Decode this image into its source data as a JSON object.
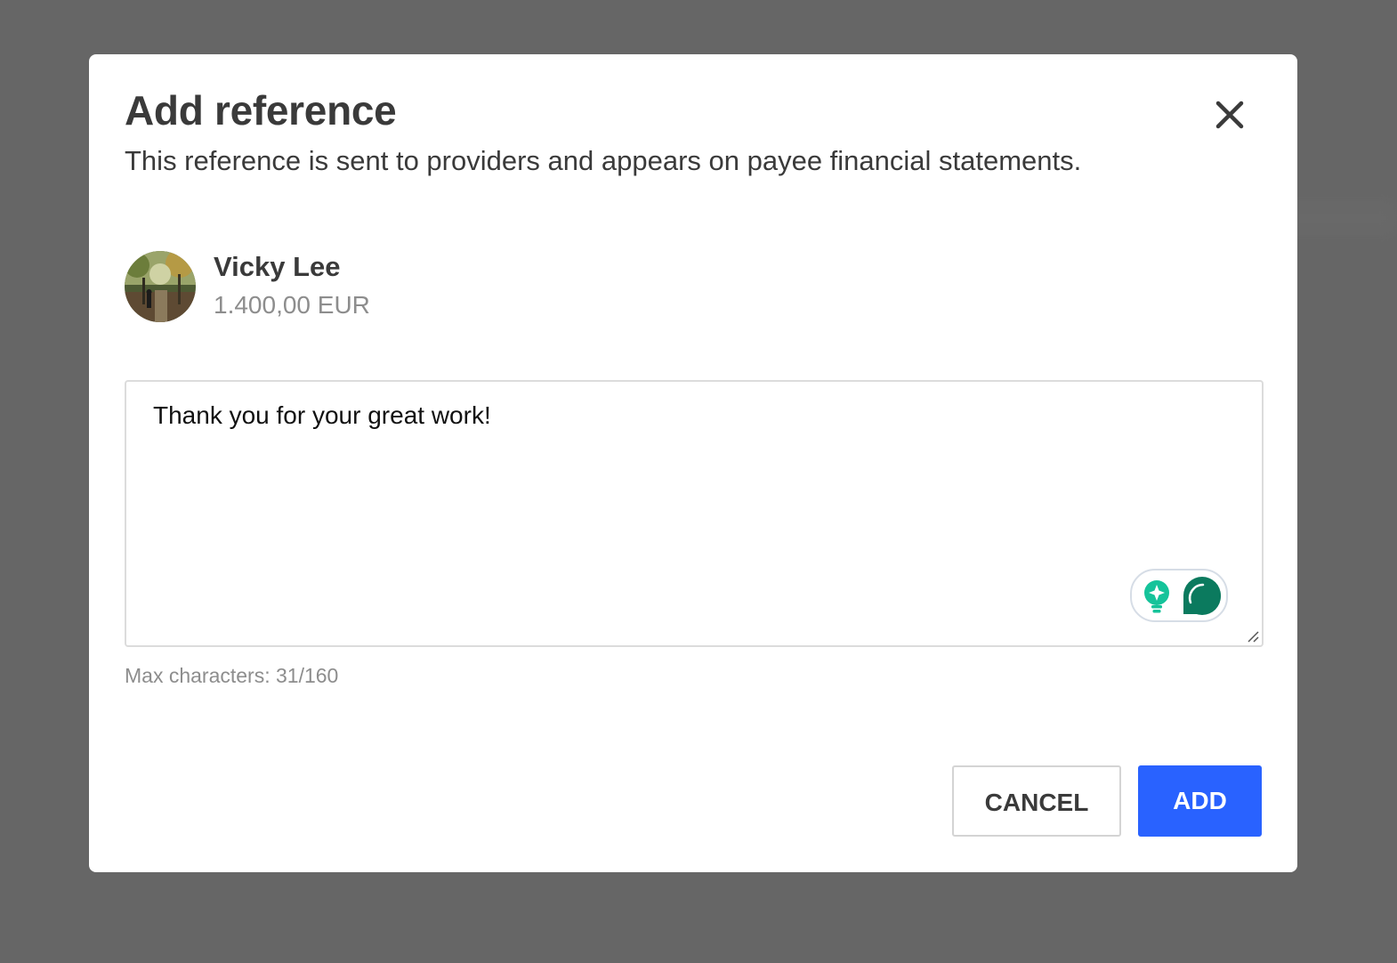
{
  "dialog": {
    "title": "Add reference",
    "subtitle": "This reference is sent to providers and appears on payee financial statements.",
    "close_icon": "close-icon"
  },
  "payee": {
    "name": "Vicky Lee",
    "amount": "1.400,00 EUR",
    "avatar_icon": "avatar-photo"
  },
  "reference": {
    "value": "Thank you for your great work!",
    "counter": "Max characters: 31/160"
  },
  "widget": {
    "icons": [
      "lightbulb-icon",
      "grammarly-icon"
    ],
    "colors": {
      "teal": "#15c39a",
      "dark_green": "#0b7a5e"
    }
  },
  "actions": {
    "cancel_label": "CANCEL",
    "add_label": "ADD"
  },
  "colors": {
    "primary": "#2962ff",
    "overlay": "#666666"
  }
}
